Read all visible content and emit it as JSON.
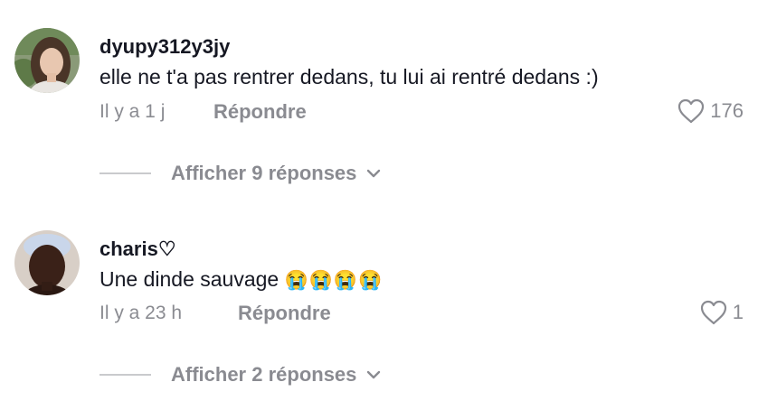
{
  "comments": [
    {
      "username": "dyupy312y3jy",
      "text": "elle ne t'a pas rentrer dedans, tu lui ai rentré dedans :)",
      "time": "Il y a 1 j",
      "reply_label": "Répondre",
      "likes": "176",
      "show_replies_label": "Afficher 9 réponses"
    },
    {
      "username": "charis♡",
      "text": "Une dinde sauvage",
      "emojis": "😭😭😭😭",
      "time": "Il y a 23 h",
      "reply_label": "Répondre",
      "likes": "1",
      "show_replies_label": "Afficher 2 réponses"
    }
  ],
  "icons": {
    "like": "heart-outline-icon",
    "expand": "chevron-down-icon"
  },
  "colors": {
    "primary_text": "#161823",
    "secondary_text": "#8a8b91",
    "divider": "#c9cacd"
  }
}
